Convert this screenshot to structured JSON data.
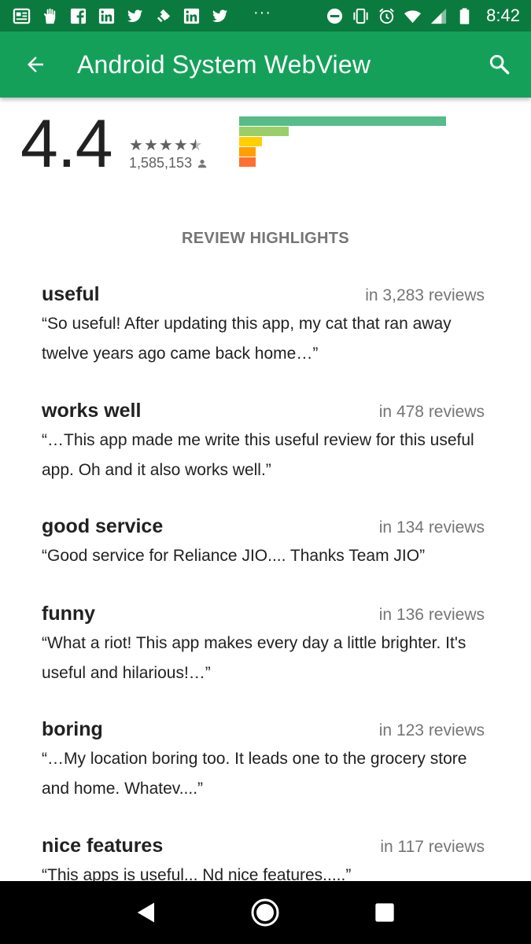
{
  "status_bar": {
    "time": "8:42",
    "left_icons": [
      "news-icon",
      "hand-icon",
      "facebook-icon",
      "linkedin-icon",
      "twitter-icon",
      "feedly-icon",
      "linkedin-icon",
      "twitter-icon"
    ],
    "overflow": "···"
  },
  "app_bar": {
    "title": "Android System WebView"
  },
  "rating": {
    "score": "4.4",
    "stars": 4.5,
    "count": "1,585,153",
    "distribution_fractions": [
      1.0,
      0.24,
      0.11,
      0.08,
      0.08
    ],
    "distribution_colors": [
      "#57bb8a",
      "#9ace6a",
      "#ffcf02",
      "#ff9f02",
      "#ff6f31"
    ]
  },
  "section_title": "REVIEW HIGHLIGHTS",
  "highlights": [
    {
      "keyword": "useful",
      "count": "in 3,283 reviews",
      "quote": "“So useful! After updating this app, my cat that ran away twelve years ago came back home…”"
    },
    {
      "keyword": "works well",
      "count": "in 478 reviews",
      "quote": "“…This app made me write this useful review for this useful app. Oh and it also works well.”"
    },
    {
      "keyword": "good service",
      "count": "in 134 reviews",
      "quote": "“Good service for Reliance JIO.... Thanks Team JIO”"
    },
    {
      "keyword": "funny",
      "count": "in 136 reviews",
      "quote": "“What a riot! This app makes every day a little brighter. It's useful and hilarious!…”"
    },
    {
      "keyword": "boring",
      "count": "in 123 reviews",
      "quote": "“…My location boring too. It leads one to the grocery store and home. Whatev....”"
    },
    {
      "keyword": "nice features",
      "count": "in 117 reviews",
      "quote": "“This apps is useful... Nd nice features.....”"
    }
  ]
}
